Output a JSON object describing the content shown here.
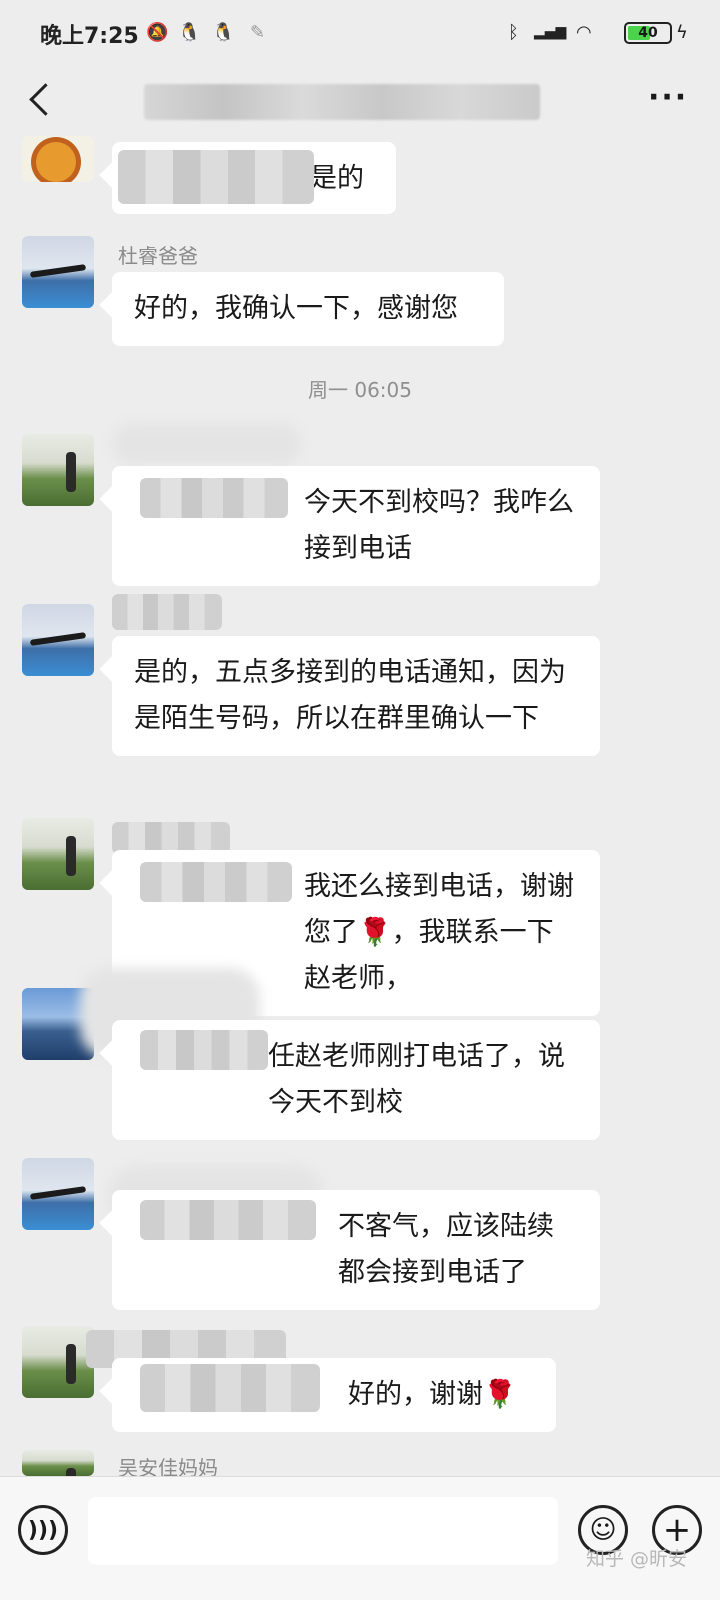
{
  "status_bar": {
    "time": "晚上7:25",
    "battery": "40",
    "icons": [
      "mute-icon",
      "qq-icon",
      "qq-icon",
      "feather-icon",
      "bluetooth-icon",
      "hd-signal-icon",
      "wifi-icon",
      "charging-icon"
    ]
  },
  "nav": {
    "more": "···",
    "back_icon": "chevron-left-icon"
  },
  "timestamp": "周一 06:05",
  "messages": [
    {
      "text": "是的"
    },
    {
      "sender": "杜睿爸爸",
      "text": "好的，我确认一下，感谢您"
    },
    {
      "text": "今天不到校吗？我咋么接到电话"
    },
    {
      "text": "是的，五点多接到的电话通知，因为是陌生号码，所以在群里确认一下"
    },
    {
      "text": "我还么接到电话，谢谢您了",
      "text_after": "，我联系一下赵老师，",
      "emoji": "🌹"
    },
    {
      "text": "任赵老师刚打电话了，说今天不到校"
    },
    {
      "text": "不客气，应该陆续都会接到电话了"
    },
    {
      "text": "好的，谢谢",
      "emoji": "🌹"
    },
    {
      "sender": "吴安佳妈妈"
    }
  ],
  "input_bar": {
    "placeholder": ""
  },
  "watermark": "知乎 @昕安"
}
